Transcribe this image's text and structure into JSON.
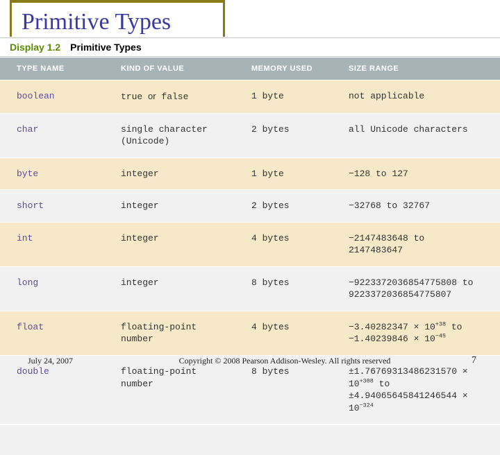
{
  "title": "Primitive Types",
  "display": {
    "label": "Display 1.2",
    "text": "Primitive Types"
  },
  "headers": [
    "TYPE NAME",
    "KIND OF VALUE",
    "MEMORY USED",
    "SIZE RANGE"
  ],
  "rows": [
    {
      "name": "boolean",
      "kind_html": "<span class='mono'>true</span> <span class='or'>or</span> <span class='mono'>false</span>",
      "mem": "1 byte",
      "range_html": "not applicable"
    },
    {
      "name": "char",
      "kind_html": "single character<br>(Unicode)",
      "mem": "2 bytes",
      "range_html": "all Unicode characters"
    },
    {
      "name": "byte",
      "kind_html": "integer",
      "mem": "1 byte",
      "range_html": "−128 to 127"
    },
    {
      "name": "short",
      "kind_html": "integer",
      "mem": "2 bytes",
      "range_html": "−32768 to 32767"
    },
    {
      "name": "int",
      "kind_html": "integer",
      "mem": "4 bytes",
      "range_html": "−2147483648 to<br>2147483647"
    },
    {
      "name": "long",
      "kind_html": "integer",
      "mem": "8 bytes",
      "range_html": "−9223372036854775808 to<br>9223372036854775807"
    },
    {
      "name": "float",
      "kind_html": "floating-point<br>number",
      "mem": "4 bytes",
      "range_html": "−3.40282347 × 10<sup>+38</sup> to<br>−1.40239846 × 10<sup>−45</sup>"
    },
    {
      "name": "double",
      "kind_html": "floating-point<br>number",
      "mem": "8 bytes",
      "range_html": "±1.76769313486231570 × 10<sup>+308</sup> to<br>±4.94065645841246544 × 10<sup>−324</sup>"
    }
  ],
  "footer": {
    "date": "July 24, 2007",
    "copyright": "Copyright © 2008 Pearson Addison-Wesley. All rights reserved",
    "page": "7"
  }
}
